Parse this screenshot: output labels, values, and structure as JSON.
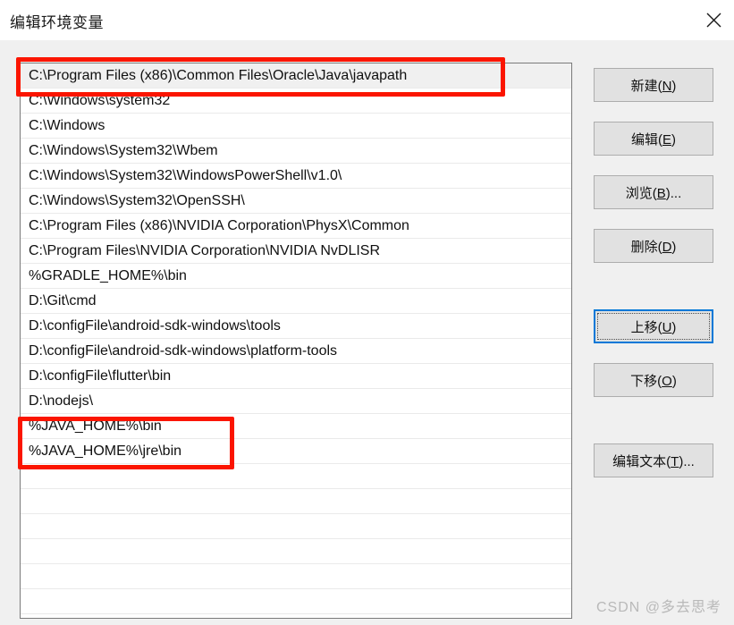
{
  "window": {
    "title": "编辑环境变量",
    "close_icon": "close-icon"
  },
  "path_list": {
    "selected_index": 0,
    "items": [
      "C:\\Program Files (x86)\\Common Files\\Oracle\\Java\\javapath",
      "C:\\Windows\\system32",
      "C:\\Windows",
      "C:\\Windows\\System32\\Wbem",
      "C:\\Windows\\System32\\WindowsPowerShell\\v1.0\\",
      "C:\\Windows\\System32\\OpenSSH\\",
      "C:\\Program Files (x86)\\NVIDIA Corporation\\PhysX\\Common",
      "C:\\Program Files\\NVIDIA Corporation\\NVIDIA NvDLISR",
      "%GRADLE_HOME%\\bin",
      "D:\\Git\\cmd",
      "D:\\configFile\\android-sdk-windows\\tools",
      "D:\\configFile\\android-sdk-windows\\platform-tools",
      "D:\\configFile\\flutter\\bin",
      "D:\\nodejs\\",
      "%JAVA_HOME%\\bin",
      "%JAVA_HOME%\\jre\\bin"
    ],
    "empty_row_count": 6
  },
  "buttons": {
    "new": "新建(N)",
    "new_mnemonic": "N",
    "edit": "编辑(E)",
    "edit_mnemonic": "E",
    "browse": "浏览(B)...",
    "browse_mnemonic": "B",
    "delete": "删除(D)",
    "delete_mnemonic": "D",
    "move_up": "上移(U)",
    "move_up_mnemonic": "U",
    "move_down": "下移(O)",
    "move_down_mnemonic": "O",
    "edit_text": "编辑文本(T)...",
    "edit_text_mnemonic": "T",
    "focused_button": "move_up"
  },
  "annotations": {
    "accent_color": "#fb1500",
    "boxes": [
      {
        "name": "javapath-highlight",
        "target": "C:\\Program Files (x86)\\Common Files\\Oracle\\Java\\javapath"
      },
      {
        "name": "java-home-highlight",
        "target": "%JAVA_HOME%\\bin and %JAVA_HOME%\\jre\\bin"
      }
    ]
  },
  "watermark": {
    "text": "CSDN @多去思考"
  },
  "colors": {
    "window_background": "#f0f0f0",
    "titlebar_background": "#ffffff",
    "list_background": "#ffffff",
    "list_selected_background": "#f0f0f0",
    "button_background": "#e1e1e1",
    "focus_border": "#0078d7",
    "annotation_red": "#fb1500"
  }
}
